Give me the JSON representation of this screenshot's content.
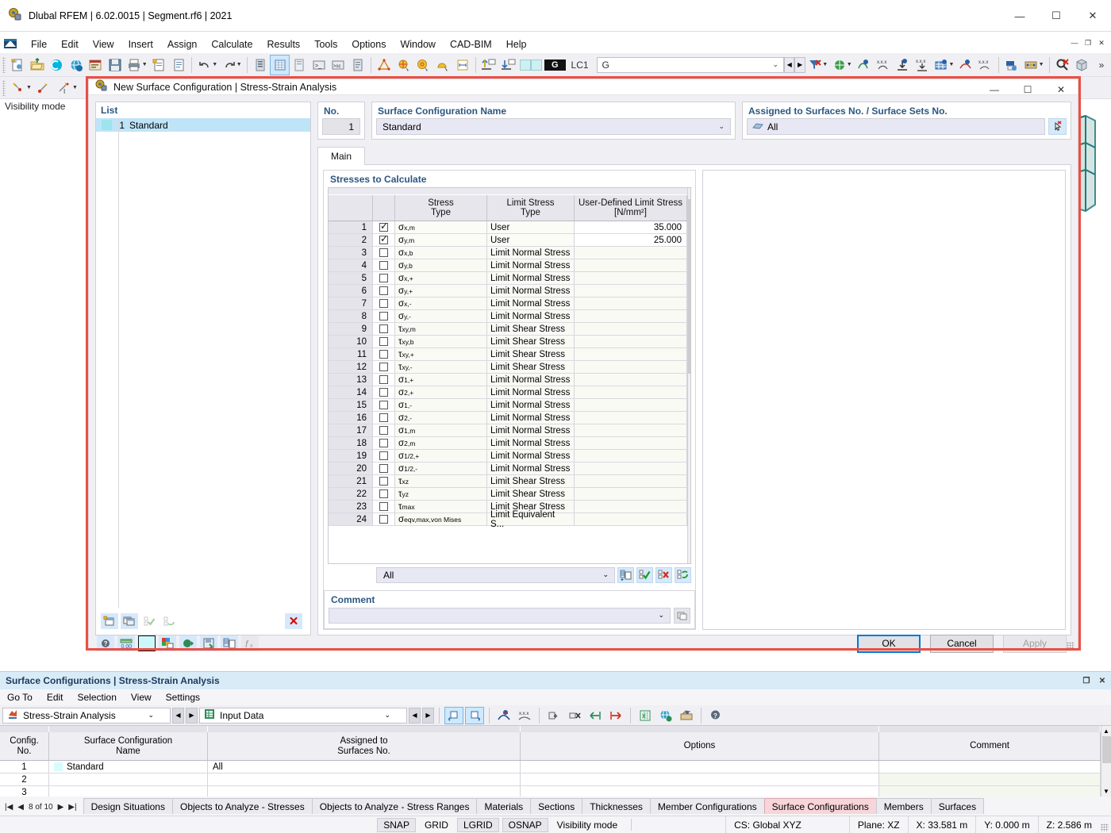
{
  "window": {
    "title": "Dlubal RFEM | 6.02.0015 | Segment.rf6 | 2021",
    "minimize": "—",
    "maximize": "☐",
    "close": "✕"
  },
  "menu": {
    "items": [
      "File",
      "Edit",
      "View",
      "Insert",
      "Assign",
      "Calculate",
      "Results",
      "Tools",
      "Options",
      "Window",
      "CAD-BIM",
      "Help"
    ],
    "mdi": [
      "—",
      "❐",
      "✕"
    ]
  },
  "toolbar": {
    "load_case_tag": "G",
    "load_case_id": "LC1",
    "load_case_value": "G",
    "chevron": "⌄",
    "prev": "◀",
    "next": "▶",
    "overflow": "»"
  },
  "viewport": {
    "visibility_mode_label": "Visibility mode"
  },
  "dialog": {
    "title": "New Surface Configuration | Stress-Strain Analysis",
    "minimize": "—",
    "maximize": "☐",
    "close": "✕",
    "list": {
      "label": "List",
      "items": [
        {
          "no": "1",
          "name": "Standard"
        }
      ],
      "footer_buttons": [
        "new-icon",
        "copy-icon",
        "check-icon",
        "reset-icon"
      ],
      "delete_label": "✕"
    },
    "no_label": "No.",
    "no_value": "1",
    "name_label": "Surface Configuration Name",
    "name_value": "Standard",
    "assigned_label": "Assigned to Surfaces No. / Surface Sets No.",
    "assigned_value": "All",
    "tabs": [
      {
        "label": "Main",
        "active": true
      }
    ],
    "stresses": {
      "group_label": "Stresses to Calculate",
      "columns": [
        "",
        "",
        "Stress\nType",
        "Limit Stress\nType",
        "User-Defined Limit Stress\n[N/mm²]"
      ],
      "col_stress_type_l1": "Stress",
      "col_stress_type_l2": "Type",
      "col_limit_type_l1": "Limit Stress",
      "col_limit_type_l2": "Type",
      "col_user_l1": "User-Defined Limit Stress",
      "col_user_l2": "[N/mm²]",
      "rows": [
        {
          "no": "1",
          "checked": true,
          "stress_base": "σ",
          "stress_sub": "x,m",
          "limit": "User",
          "value": "35.000"
        },
        {
          "no": "2",
          "checked": true,
          "stress_base": "σ",
          "stress_sub": "y,m",
          "limit": "User",
          "value": "25.000"
        },
        {
          "no": "3",
          "checked": false,
          "stress_base": "σ",
          "stress_sub": "x,b",
          "limit": "Limit Normal Stress",
          "value": ""
        },
        {
          "no": "4",
          "checked": false,
          "stress_base": "σ",
          "stress_sub": "y,b",
          "limit": "Limit Normal Stress",
          "value": ""
        },
        {
          "no": "5",
          "checked": false,
          "stress_base": "σ",
          "stress_sub": "x,+",
          "limit": "Limit Normal Stress",
          "value": ""
        },
        {
          "no": "6",
          "checked": false,
          "stress_base": "σ",
          "stress_sub": "y,+",
          "limit": "Limit Normal Stress",
          "value": ""
        },
        {
          "no": "7",
          "checked": false,
          "stress_base": "σ",
          "stress_sub": "x,-",
          "limit": "Limit Normal Stress",
          "value": ""
        },
        {
          "no": "8",
          "checked": false,
          "stress_base": "σ",
          "stress_sub": "y,-",
          "limit": "Limit Normal Stress",
          "value": ""
        },
        {
          "no": "9",
          "checked": false,
          "stress_base": "τ",
          "stress_sub": "xy,m",
          "limit": "Limit Shear Stress",
          "value": ""
        },
        {
          "no": "10",
          "checked": false,
          "stress_base": "τ",
          "stress_sub": "xy,b",
          "limit": "Limit Shear Stress",
          "value": ""
        },
        {
          "no": "11",
          "checked": false,
          "stress_base": "τ",
          "stress_sub": "xy,+",
          "limit": "Limit Shear Stress",
          "value": ""
        },
        {
          "no": "12",
          "checked": false,
          "stress_base": "τ",
          "stress_sub": "xy,-",
          "limit": "Limit Shear Stress",
          "value": ""
        },
        {
          "no": "13",
          "checked": false,
          "stress_base": "σ",
          "stress_sub": "1,+",
          "limit": "Limit Normal Stress",
          "value": ""
        },
        {
          "no": "14",
          "checked": false,
          "stress_base": "σ",
          "stress_sub": "2,+",
          "limit": "Limit Normal Stress",
          "value": ""
        },
        {
          "no": "15",
          "checked": false,
          "stress_base": "σ",
          "stress_sub": "1,-",
          "limit": "Limit Normal Stress",
          "value": ""
        },
        {
          "no": "16",
          "checked": false,
          "stress_base": "σ",
          "stress_sub": "2,-",
          "limit": "Limit Normal Stress",
          "value": ""
        },
        {
          "no": "17",
          "checked": false,
          "stress_base": "σ",
          "stress_sub": "1,m",
          "limit": "Limit Normal Stress",
          "value": ""
        },
        {
          "no": "18",
          "checked": false,
          "stress_base": "σ",
          "stress_sub": "2,m",
          "limit": "Limit Normal Stress",
          "value": ""
        },
        {
          "no": "19",
          "checked": false,
          "stress_base": "σ",
          "stress_sub": "1/2,+",
          "limit": "Limit Normal Stress",
          "value": ""
        },
        {
          "no": "20",
          "checked": false,
          "stress_base": "σ",
          "stress_sub": "1/2,-",
          "limit": "Limit Normal Stress",
          "value": ""
        },
        {
          "no": "21",
          "checked": false,
          "stress_base": "τ",
          "stress_sub": "xz",
          "limit": "Limit Shear Stress",
          "value": ""
        },
        {
          "no": "22",
          "checked": false,
          "stress_base": "τ",
          "stress_sub": "yz",
          "limit": "Limit Shear Stress",
          "value": ""
        },
        {
          "no": "23",
          "checked": false,
          "stress_base": "τ",
          "stress_sub": "max",
          "limit": "Limit Shear Stress",
          "value": ""
        },
        {
          "no": "24",
          "checked": false,
          "stress_base": "σ",
          "stress_sub": "eqv,max,von Mises",
          "limit": "Limit Equivalent S...",
          "value": ""
        }
      ],
      "filter_value": "All",
      "filter_buttons": [
        "import-icon",
        "select-all-icon",
        "deselect-all-icon",
        "invert-selection-icon"
      ]
    },
    "comment": {
      "label": "Comment",
      "value": "",
      "button": "copy-icon"
    },
    "footer_buttons": [
      "help-icon",
      "units-icon",
      "color-swatch",
      "render-icon",
      "export-icon",
      "save-icon",
      "list-icon",
      "formula-icon"
    ],
    "ok_label": "OK",
    "cancel_label": "Cancel",
    "apply_label": "Apply"
  },
  "bottom_panel": {
    "title": "Surface Configurations | Stress-Strain Analysis",
    "win_buttons": [
      "❐",
      "✕"
    ],
    "menu": [
      "Go To",
      "Edit",
      "Selection",
      "View",
      "Settings"
    ],
    "combo1": "Stress-Strain Analysis",
    "combo2": "Input Data",
    "chevron": "⌄",
    "prev": "◀",
    "next": "▶",
    "table": {
      "headers": [
        {
          "l1": "Config.",
          "l2": "No."
        },
        {
          "l1": "Surface Configuration",
          "l2": "Name"
        },
        {
          "l1": "Assigned to",
          "l2": "Surfaces No."
        },
        {
          "l1": "",
          "l2": "Options"
        },
        {
          "l1": "",
          "l2": "Comment"
        }
      ],
      "rows": [
        {
          "no": "1",
          "name": "Standard",
          "assigned": "All",
          "options": "",
          "comment": "",
          "swatch": true
        },
        {
          "no": "2",
          "name": "",
          "assigned": "",
          "options": "",
          "comment": "",
          "swatch": false
        },
        {
          "no": "3",
          "name": "",
          "assigned": "",
          "options": "",
          "comment": "",
          "swatch": false
        }
      ]
    }
  },
  "page_tabs": {
    "nav": {
      "first": "|◀",
      "prev": "◀",
      "next": "▶",
      "last": "▶|"
    },
    "counter": "8 of 10",
    "tabs": [
      {
        "label": "Design Situations",
        "active": false
      },
      {
        "label": "Objects to Analyze - Stresses",
        "active": false
      },
      {
        "label": "Objects to Analyze - Stress Ranges",
        "active": false
      },
      {
        "label": "Materials",
        "active": false
      },
      {
        "label": "Sections",
        "active": false
      },
      {
        "label": "Thicknesses",
        "active": false
      },
      {
        "label": "Member Configurations",
        "active": false
      },
      {
        "label": "Surface Configurations",
        "active": true
      },
      {
        "label": "Members",
        "active": false
      },
      {
        "label": "Surfaces",
        "active": false
      }
    ]
  },
  "status_bar": {
    "toggles": [
      {
        "label": "SNAP",
        "on": true
      },
      {
        "label": "GRID",
        "on": false
      },
      {
        "label": "LGRID",
        "on": true
      },
      {
        "label": "OSNAP",
        "on": true
      }
    ],
    "visibility_mode": "Visibility mode",
    "cs": "CS: Global XYZ",
    "plane": "Plane: XZ",
    "x": "X: 33.581 m",
    "y": "Y: 0.000 m",
    "z": "Z: 2.586 m"
  },
  "colors": {
    "accent_red": "#ec4f43",
    "header_blue": "#2c5783",
    "active_tab_pink": "#f7d5d9",
    "selection_blue": "#bfe4f8"
  }
}
